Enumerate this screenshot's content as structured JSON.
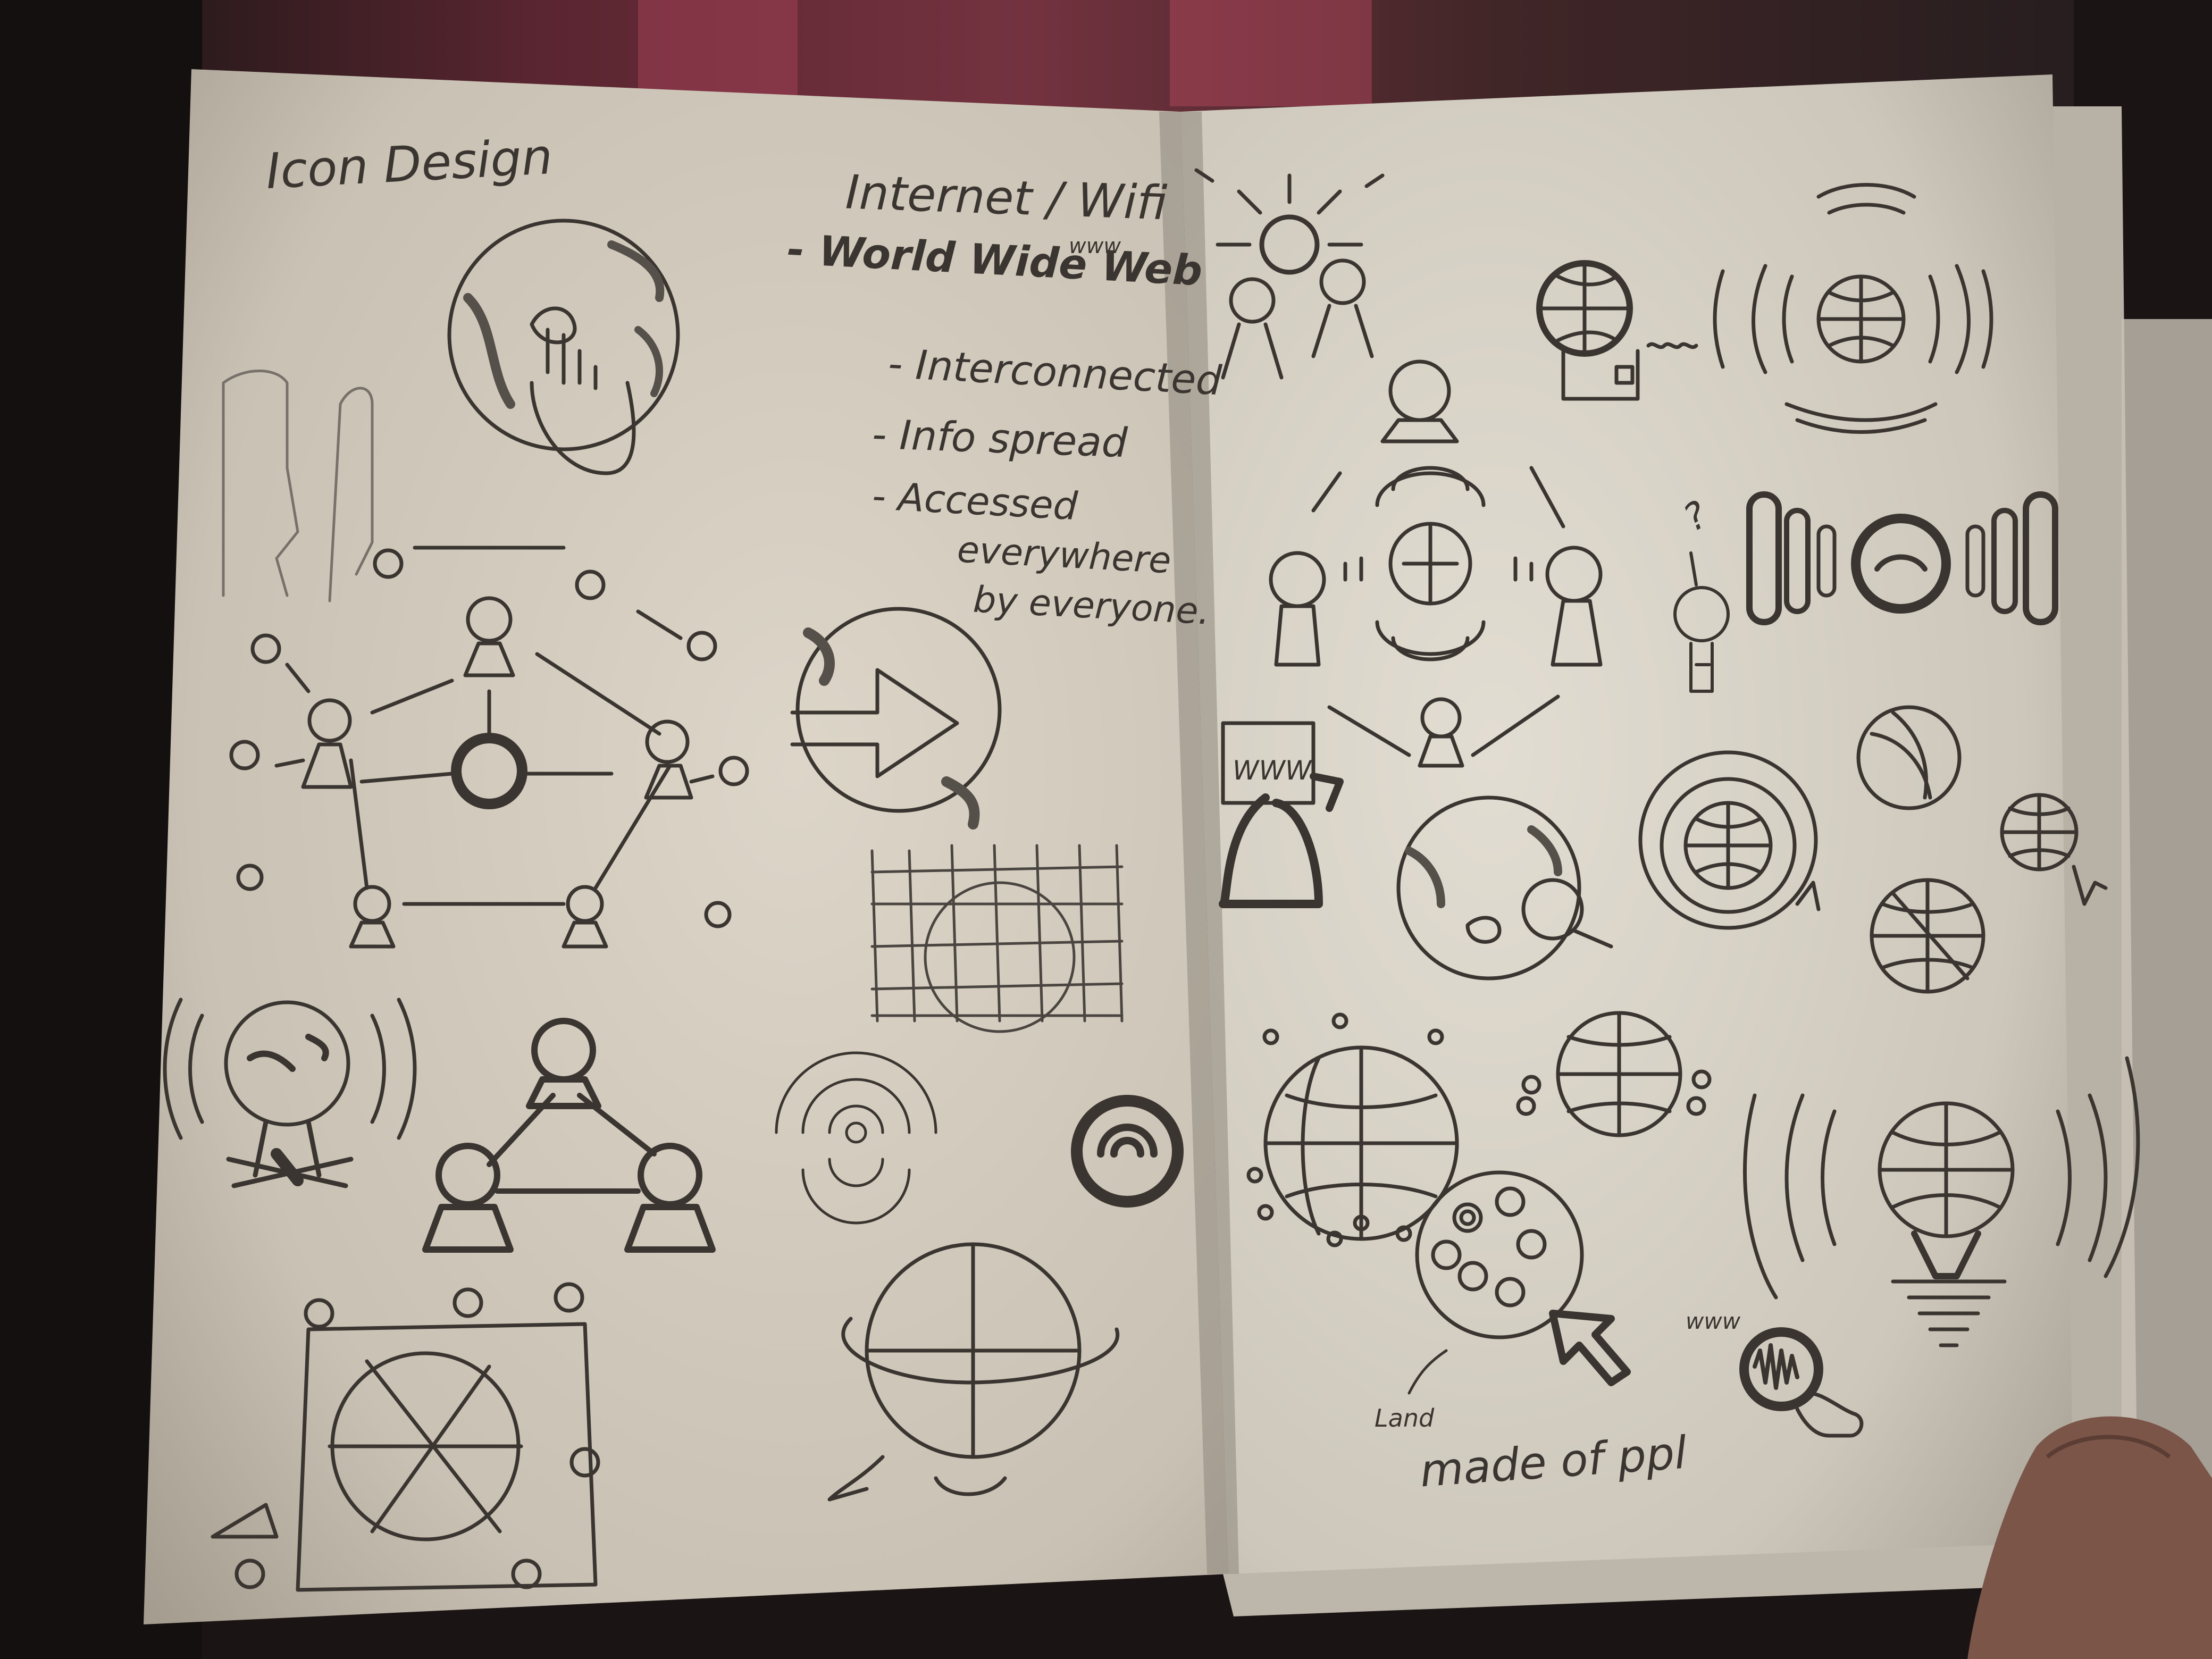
{
  "left_page": {
    "heading": "Icon Design",
    "topic": "Internet / Wifi",
    "notes": [
      "- World Wide Web",
      "- Interconnected",
      "- Info spread",
      "- Accessed",
      "everywhere",
      "by everyone."
    ],
    "www_small": "www"
  },
  "right_page": {
    "www_screen": "WWW",
    "www_hand": "www",
    "question_mark": "?",
    "caption_land": "Land",
    "caption_rest": "made of ppl"
  }
}
